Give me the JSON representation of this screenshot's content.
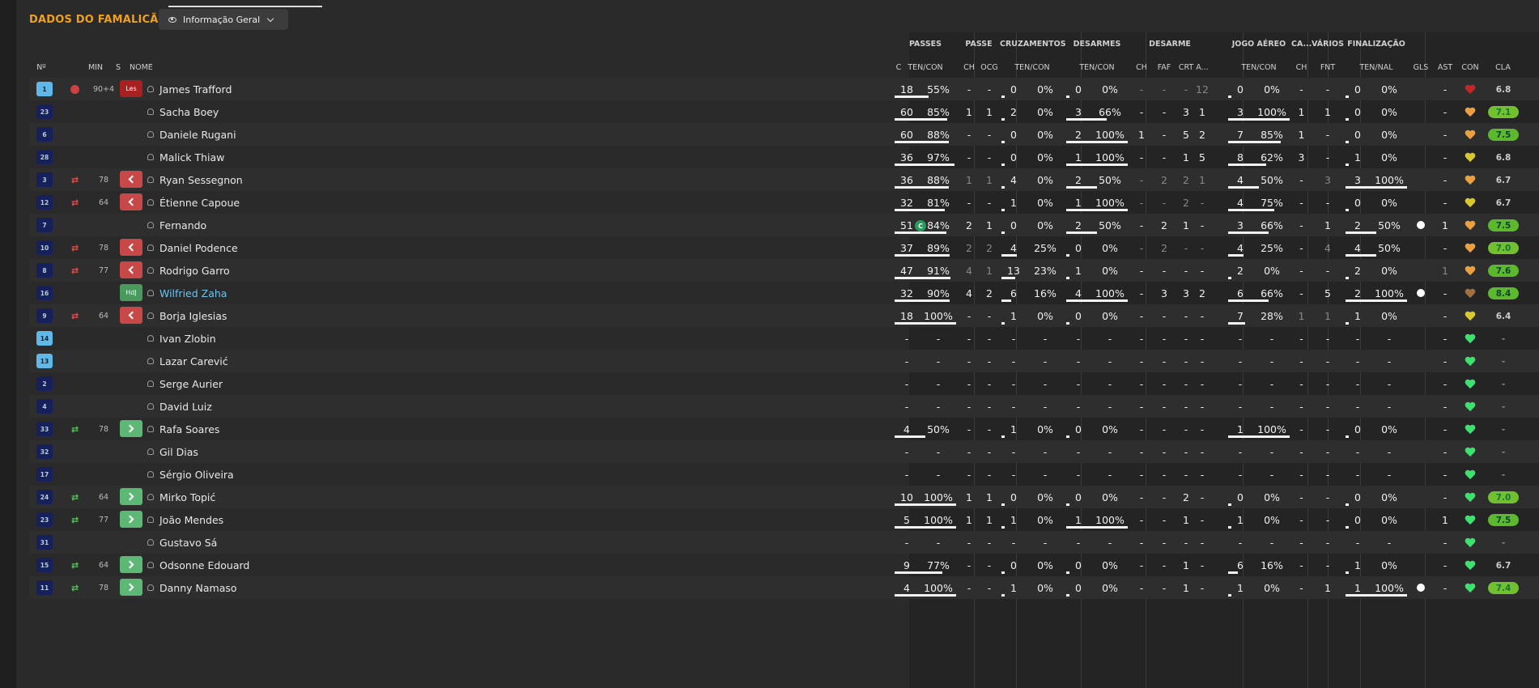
{
  "header": {
    "title": "DADOS DO FAMALICÃO",
    "view_label": "Informação Geral"
  },
  "columns": {
    "num": "Nº",
    "min": "MIN",
    "s": "S",
    "name": "NOME",
    "c": "C",
    "groups": {
      "passes": "PASSES",
      "passe": "PASSE",
      "cruzamentos": "CRUZAMENTOS",
      "desarmes": "DESARMES",
      "desarme": "DESARME",
      "jogo_aereo": "JOGO AÉREO",
      "ca": "CA...",
      "varios": "VÁRIOS",
      "finalizacao": "FINALIZAÇÃO"
    },
    "sub": {
      "passes": "TEN/CON",
      "passe_ch": "CH",
      "passe_ocg": "OCG",
      "cruz": "TEN/CON",
      "des": "TEN/CON",
      "desa_ch": "CH",
      "desa_faf": "FAF",
      "desa_crt": "CRT",
      "desa_a": "A...",
      "aereo": "TEN/CON",
      "ca_ch": "CH",
      "fnt": "FNT",
      "fin": "TEN/NAL",
      "gls": "GLS",
      "ast": "AST",
      "con": "CON",
      "cla": "CLA"
    }
  },
  "colors": {
    "accent": "#f0a020",
    "positive": "#60c060",
    "negative": "#c84848",
    "heart_high": "#3ee070"
  },
  "players": [
    {
      "num": "1",
      "gk": true,
      "status": "injury",
      "min": "90+4",
      "s": "Les",
      "name": "James Trafford",
      "captain": false,
      "passes": [
        "18",
        "55%"
      ],
      "passes_pct": 55,
      "passe": [
        "-",
        "-"
      ],
      "cruz": [
        "0",
        "0%"
      ],
      "cruz_pct": 0,
      "des": [
        "0",
        "0%"
      ],
      "des_pct": 0,
      "desa": [
        "-",
        "-",
        "-",
        "12"
      ],
      "aereo": [
        "0",
        "0%"
      ],
      "aereo_pct": 0,
      "ca": "-",
      "fnt": "-",
      "fin": [
        "0",
        "0%"
      ],
      "fin_pct": 0,
      "gls": "",
      "ast": "-",
      "con": "red",
      "cla": "6.8",
      "cla_style": "plain"
    },
    {
      "num": "23",
      "gk": false,
      "status": "",
      "min": "",
      "s": "",
      "name": "Sacha Boey",
      "captain": false,
      "passes": [
        "60",
        "85%"
      ],
      "passes_pct": 85,
      "passe": [
        "1",
        "1"
      ],
      "cruz": [
        "2",
        "0%"
      ],
      "cruz_pct": 0,
      "des": [
        "3",
        "66%"
      ],
      "des_pct": 66,
      "desa": [
        "-",
        "-",
        "3",
        "1"
      ],
      "aereo": [
        "3",
        "100%"
      ],
      "aereo_pct": 100,
      "ca": "1",
      "fnt": "1",
      "fin": [
        "0",
        "0%"
      ],
      "fin_pct": 0,
      "gls": "",
      "ast": "-",
      "con": "orange",
      "cla": "7.1",
      "cla_style": "green"
    },
    {
      "num": "6",
      "gk": false,
      "status": "",
      "min": "",
      "s": "",
      "name": "Daniele Rugani",
      "captain": false,
      "passes": [
        "60",
        "88%"
      ],
      "passes_pct": 88,
      "passe": [
        "-",
        "-"
      ],
      "cruz": [
        "0",
        "0%"
      ],
      "cruz_pct": 0,
      "des": [
        "2",
        "100%"
      ],
      "des_pct": 100,
      "desa": [
        "1",
        "-",
        "5",
        "2"
      ],
      "aereo": [
        "7",
        "85%"
      ],
      "aereo_pct": 85,
      "ca": "1",
      "fnt": "-",
      "fin": [
        "0",
        "0%"
      ],
      "fin_pct": 0,
      "gls": "",
      "ast": "-",
      "con": "orange",
      "cla": "7.5",
      "cla_style": "green"
    },
    {
      "num": "28",
      "gk": false,
      "status": "",
      "min": "",
      "s": "",
      "name": "Malick Thiaw",
      "captain": false,
      "passes": [
        "36",
        "97%"
      ],
      "passes_pct": 97,
      "passe": [
        "-",
        "-"
      ],
      "cruz": [
        "0",
        "0%"
      ],
      "cruz_pct": 0,
      "des": [
        "1",
        "100%"
      ],
      "des_pct": 100,
      "desa": [
        "-",
        "-",
        "1",
        "5"
      ],
      "aereo": [
        "8",
        "62%"
      ],
      "aereo_pct": 62,
      "ca": "3",
      "fnt": "-",
      "fin": [
        "1",
        "0%"
      ],
      "fin_pct": 0,
      "gls": "",
      "ast": "-",
      "con": "yellow",
      "cla": "6.8",
      "cla_style": "plain"
    },
    {
      "num": "3",
      "gk": false,
      "status": "out",
      "min": "78",
      "s": "out",
      "name": "Ryan Sessegnon",
      "captain": false,
      "passes": [
        "36",
        "88%"
      ],
      "passes_pct": 88,
      "passe": [
        "1",
        "1"
      ],
      "cruz": [
        "4",
        "0%"
      ],
      "cruz_pct": 0,
      "des": [
        "2",
        "50%"
      ],
      "des_pct": 50,
      "desa": [
        "-",
        "2",
        "2",
        "1"
      ],
      "aereo": [
        "4",
        "50%"
      ],
      "aereo_pct": 50,
      "ca": "-",
      "fnt": "3",
      "fin": [
        "3",
        "100%"
      ],
      "fin_pct": 100,
      "gls": "",
      "ast": "-",
      "con": "orange",
      "cla": "6.7",
      "cla_style": "plain"
    },
    {
      "num": "12",
      "gk": false,
      "status": "out",
      "min": "64",
      "s": "out",
      "name": "Étienne Capoue",
      "captain": false,
      "passes": [
        "32",
        "81%"
      ],
      "passes_pct": 81,
      "passe": [
        "-",
        "-"
      ],
      "cruz": [
        "1",
        "0%"
      ],
      "cruz_pct": 0,
      "des": [
        "1",
        "100%"
      ],
      "des_pct": 100,
      "desa": [
        "-",
        "-",
        "2",
        "-"
      ],
      "aereo": [
        "4",
        "75%"
      ],
      "aereo_pct": 75,
      "ca": "-",
      "fnt": "-",
      "fin": [
        "0",
        "0%"
      ],
      "fin_pct": 0,
      "gls": "",
      "ast": "-",
      "con": "yellow",
      "cla": "6.7",
      "cla_style": "plain"
    },
    {
      "num": "7",
      "gk": false,
      "status": "",
      "min": "",
      "s": "",
      "name": "Fernando",
      "captain": true,
      "passes": [
        "51",
        "84%"
      ],
      "passes_pct": 84,
      "passe": [
        "2",
        "1"
      ],
      "cruz": [
        "0",
        "0%"
      ],
      "cruz_pct": 0,
      "des": [
        "2",
        "50%"
      ],
      "des_pct": 50,
      "desa": [
        "-",
        "2",
        "1",
        "-"
      ],
      "aereo": [
        "3",
        "66%"
      ],
      "aereo_pct": 66,
      "ca": "-",
      "fnt": "1",
      "fin": [
        "2",
        "50%"
      ],
      "fin_pct": 50,
      "gls": "ball",
      "ast": "1",
      "con": "orange",
      "cla": "7.5",
      "cla_style": "green"
    },
    {
      "num": "10",
      "gk": false,
      "status": "out",
      "min": "78",
      "s": "out",
      "name": "Daniel Podence",
      "captain": false,
      "passes": [
        "37",
        "89%"
      ],
      "passes_pct": 89,
      "passe": [
        "2",
        "2"
      ],
      "cruz": [
        "4",
        "25%"
      ],
      "cruz_pct": 25,
      "des": [
        "0",
        "0%"
      ],
      "des_pct": 0,
      "desa": [
        "-",
        "2",
        "-",
        "-"
      ],
      "aereo": [
        "4",
        "25%"
      ],
      "aereo_pct": 25,
      "ca": "-",
      "fnt": "4",
      "fin": [
        "4",
        "50%"
      ],
      "fin_pct": 50,
      "gls": "",
      "ast": "-",
      "con": "orange",
      "cla": "7.0",
      "cla_style": "green"
    },
    {
      "num": "8",
      "gk": false,
      "status": "out",
      "min": "77",
      "s": "out",
      "name": "Rodrigo Garro",
      "captain": false,
      "passes": [
        "47",
        "91%"
      ],
      "passes_pct": 91,
      "passe": [
        "4",
        "1"
      ],
      "cruz": [
        "13",
        "23%"
      ],
      "cruz_pct": 23,
      "des": [
        "1",
        "0%"
      ],
      "des_pct": 0,
      "desa": [
        "-",
        "-",
        "-",
        "-"
      ],
      "aereo": [
        "2",
        "0%"
      ],
      "aereo_pct": 0,
      "ca": "-",
      "fnt": "-",
      "fin": [
        "2",
        "0%"
      ],
      "fin_pct": 0,
      "gls": "",
      "ast": "1",
      "con": "orange",
      "cla": "7.6",
      "cla_style": "green"
    },
    {
      "num": "16",
      "gk": false,
      "status": "",
      "min": "",
      "s": "HdJ",
      "name": "Wilfried Zaha",
      "captain": false,
      "highlight": true,
      "passes": [
        "32",
        "90%"
      ],
      "passes_pct": 90,
      "passe": [
        "4",
        "2"
      ],
      "cruz": [
        "6",
        "16%"
      ],
      "cruz_pct": 16,
      "des": [
        "4",
        "100%"
      ],
      "des_pct": 100,
      "desa": [
        "-",
        "3",
        "3",
        "2"
      ],
      "aereo": [
        "6",
        "66%"
      ],
      "aereo_pct": 66,
      "ca": "-",
      "fnt": "5",
      "fin": [
        "2",
        "100%"
      ],
      "fin_pct": 100,
      "gls": "ball",
      "ast": "-",
      "con": "brown",
      "cla": "8.4",
      "cla_style": "green"
    },
    {
      "num": "9",
      "gk": false,
      "status": "out",
      "min": "64",
      "s": "out",
      "name": "Borja Iglesias",
      "captain": false,
      "passes": [
        "18",
        "100%"
      ],
      "passes_pct": 100,
      "passe": [
        "-",
        "-"
      ],
      "cruz": [
        "1",
        "0%"
      ],
      "cruz_pct": 0,
      "des": [
        "0",
        "0%"
      ],
      "des_pct": 0,
      "desa": [
        "-",
        "-",
        "-",
        "-"
      ],
      "aereo": [
        "7",
        "28%"
      ],
      "aereo_pct": 28,
      "ca": "1",
      "fnt": "1",
      "fin": [
        "1",
        "0%"
      ],
      "fin_pct": 0,
      "gls": "",
      "ast": "-",
      "con": "yellow",
      "cla": "6.4",
      "cla_style": "plain"
    },
    {
      "num": "14",
      "gk": true,
      "status": "",
      "min": "",
      "s": "",
      "name": "Ivan Zlobin",
      "captain": false,
      "empty": true,
      "con": "green",
      "cla": "-",
      "cla_style": "blank"
    },
    {
      "num": "13",
      "gk": true,
      "status": "",
      "min": "",
      "s": "",
      "name": "Lazar Carević",
      "captain": false,
      "empty": true,
      "con": "green",
      "cla": "-",
      "cla_style": "blank"
    },
    {
      "num": "2",
      "gk": false,
      "status": "",
      "min": "",
      "s": "",
      "name": "Serge Aurier",
      "captain": false,
      "empty": true,
      "con": "green",
      "cla": "-",
      "cla_style": "blank"
    },
    {
      "num": "4",
      "gk": false,
      "status": "",
      "min": "",
      "s": "",
      "name": "David Luiz",
      "captain": false,
      "empty": true,
      "con": "green",
      "cla": "-",
      "cla_style": "blank"
    },
    {
      "num": "33",
      "gk": false,
      "status": "in",
      "min": "78",
      "s": "in",
      "name": "Rafa Soares",
      "captain": false,
      "passes": [
        "4",
        "50%"
      ],
      "passes_pct": 50,
      "passe": [
        "-",
        "-"
      ],
      "cruz": [
        "1",
        "0%"
      ],
      "cruz_pct": 0,
      "des": [
        "0",
        "0%"
      ],
      "des_pct": 0,
      "desa": [
        "-",
        "-",
        "-",
        "-"
      ],
      "aereo": [
        "1",
        "100%"
      ],
      "aereo_pct": 100,
      "ca": "-",
      "fnt": "-",
      "fin": [
        "0",
        "0%"
      ],
      "fin_pct": 0,
      "gls": "",
      "ast": "-",
      "con": "green",
      "cla": "-",
      "cla_style": "blank"
    },
    {
      "num": "32",
      "gk": false,
      "status": "",
      "min": "",
      "s": "",
      "name": "Gil Dias",
      "captain": false,
      "empty": true,
      "con": "green",
      "cla": "-",
      "cla_style": "blank"
    },
    {
      "num": "17",
      "gk": false,
      "status": "",
      "min": "",
      "s": "",
      "name": "Sérgio Oliveira",
      "captain": false,
      "empty": true,
      "con": "green",
      "cla": "-",
      "cla_style": "blank"
    },
    {
      "num": "24",
      "gk": false,
      "status": "in",
      "min": "64",
      "s": "in",
      "name": "Mirko Topić",
      "captain": false,
      "passes": [
        "10",
        "100%"
      ],
      "passes_pct": 100,
      "passe": [
        "1",
        "1"
      ],
      "cruz": [
        "0",
        "0%"
      ],
      "cruz_pct": 0,
      "des": [
        "0",
        "0%"
      ],
      "des_pct": 0,
      "desa": [
        "-",
        "-",
        "2",
        "-"
      ],
      "aereo": [
        "0",
        "0%"
      ],
      "aereo_pct": 0,
      "ca": "-",
      "fnt": "-",
      "fin": [
        "0",
        "0%"
      ],
      "fin_pct": 0,
      "gls": "",
      "ast": "-",
      "con": "green",
      "cla": "7.0",
      "cla_style": "green"
    },
    {
      "num": "23",
      "gk": false,
      "status": "in",
      "min": "77",
      "s": "in",
      "name": "João Mendes",
      "captain": false,
      "passes": [
        "5",
        "100%"
      ],
      "passes_pct": 100,
      "passe": [
        "1",
        "1"
      ],
      "cruz": [
        "1",
        "0%"
      ],
      "cruz_pct": 0,
      "des": [
        "1",
        "100%"
      ],
      "des_pct": 100,
      "desa": [
        "-",
        "-",
        "1",
        "-"
      ],
      "aereo": [
        "1",
        "0%"
      ],
      "aereo_pct": 0,
      "ca": "-",
      "fnt": "-",
      "fin": [
        "0",
        "0%"
      ],
      "fin_pct": 0,
      "gls": "",
      "ast": "1",
      "con": "green",
      "cla": "7.5",
      "cla_style": "green"
    },
    {
      "num": "31",
      "gk": false,
      "status": "",
      "min": "",
      "s": "",
      "name": "Gustavo Sá",
      "captain": false,
      "empty": true,
      "con": "green",
      "cla": "-",
      "cla_style": "blank"
    },
    {
      "num": "15",
      "gk": false,
      "status": "in",
      "min": "64",
      "s": "in",
      "name": "Odsonne Edouard",
      "captain": false,
      "passes": [
        "9",
        "77%"
      ],
      "passes_pct": 77,
      "passe": [
        "-",
        "-"
      ],
      "cruz": [
        "0",
        "0%"
      ],
      "cruz_pct": 0,
      "des": [
        "0",
        "0%"
      ],
      "des_pct": 0,
      "desa": [
        "-",
        "-",
        "1",
        "-"
      ],
      "aereo": [
        "6",
        "16%"
      ],
      "aereo_pct": 16,
      "ca": "-",
      "fnt": "-",
      "fin": [
        "1",
        "0%"
      ],
      "fin_pct": 0,
      "gls": "",
      "ast": "-",
      "con": "green",
      "cla": "6.7",
      "cla_style": "plain"
    },
    {
      "num": "11",
      "gk": false,
      "status": "in",
      "min": "78",
      "s": "in",
      "name": "Danny Namaso",
      "captain": false,
      "passes": [
        "4",
        "100%"
      ],
      "passes_pct": 100,
      "passe": [
        "-",
        "-"
      ],
      "cruz": [
        "1",
        "0%"
      ],
      "cruz_pct": 0,
      "des": [
        "0",
        "0%"
      ],
      "des_pct": 0,
      "desa": [
        "-",
        "-",
        "1",
        "-"
      ],
      "aereo": [
        "1",
        "0%"
      ],
      "aereo_pct": 0,
      "ca": "-",
      "fnt": "1",
      "fin": [
        "1",
        "100%"
      ],
      "fin_pct": 100,
      "gls": "ball",
      "ast": "-",
      "con": "green",
      "cla": "7.4",
      "cla_style": "green"
    }
  ]
}
